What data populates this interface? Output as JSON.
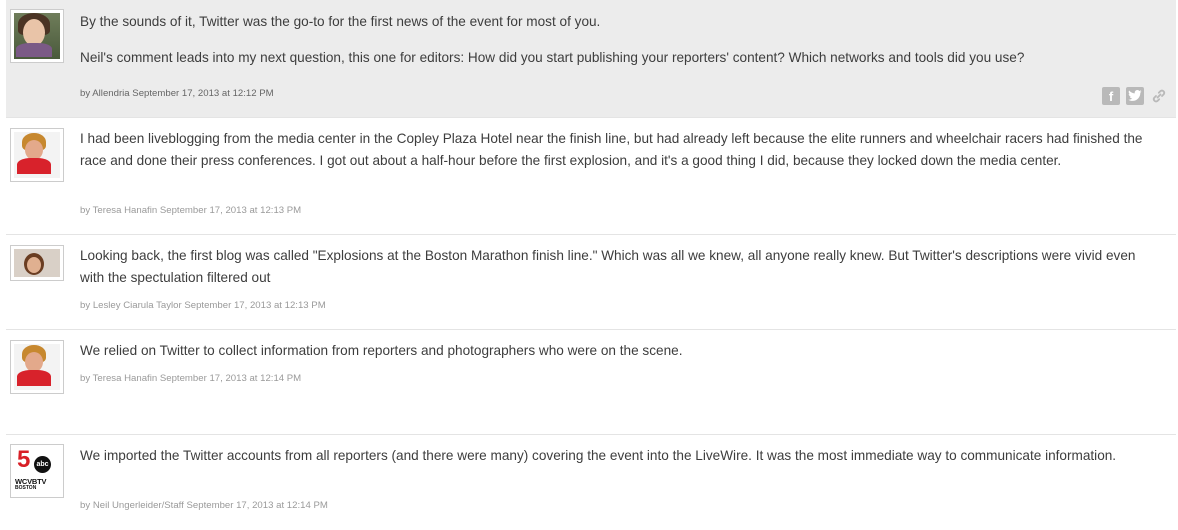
{
  "entries": [
    {
      "paragraphs": [
        "By the sounds of it, Twitter was the go-to for the first news of the event for most of you.",
        "Neil's comment leads into my next question, this one for editors: How did you start publishing your reporters' content? Which networks and tools did you use?"
      ],
      "by": "by",
      "author": "Allendria",
      "timestamp": "September 17, 2013 at 12:12 PM",
      "avatar_icon": "person-photo-allendria",
      "share": [
        {
          "icon": "facebook-icon",
          "glyph": "f"
        },
        {
          "icon": "twitter-icon",
          "glyph": "t"
        },
        {
          "icon": "link-icon",
          "glyph": "🔗"
        }
      ]
    },
    {
      "paragraphs": [
        "I had been liveblogging from the media center in the Copley Plaza Hotel near the finish line, but had already left because the elite runners and wheelchair racers had finished the race and done their press conferences. I got out about a half-hour before the first explosion, and it's a good thing I did, because they locked down the media center."
      ],
      "by": "by",
      "author": "Teresa Hanafin",
      "timestamp": "September 17, 2013 at 12:13 PM",
      "avatar_icon": "person-photo-teresa"
    },
    {
      "paragraphs": [
        "Looking back, the first blog was called \"Explosions at the Boston Marathon finish line.\" Which was all we knew, all anyone really knew. But Twitter's descriptions were vivid even with the spectulation filtered out"
      ],
      "by": "by",
      "author": "Lesley Ciarula Taylor",
      "timestamp": "September 17, 2013 at 12:13 PM",
      "avatar_icon": "person-photo-lesley"
    },
    {
      "paragraphs": [
        "We relied on Twitter to collect information from reporters and photographers who were on the scene."
      ],
      "by": "by",
      "author": "Teresa Hanafin",
      "timestamp": "September 17, 2013 at 12:14 PM",
      "avatar_icon": "person-photo-teresa"
    },
    {
      "paragraphs": [
        "We imported the Twitter accounts from all reporters (and there were many) covering the event into the LiveWire. It was the most immediate way to communicate information."
      ],
      "by": "by",
      "author": "Neil Ungerleider/Staff",
      "timestamp": "September 17, 2013 at 12:14 PM",
      "avatar_icon": "wcvb-logo",
      "logo_text": {
        "five": "5",
        "network": "abc",
        "call": "WCVBTV",
        "city": "BOSTON"
      }
    }
  ]
}
